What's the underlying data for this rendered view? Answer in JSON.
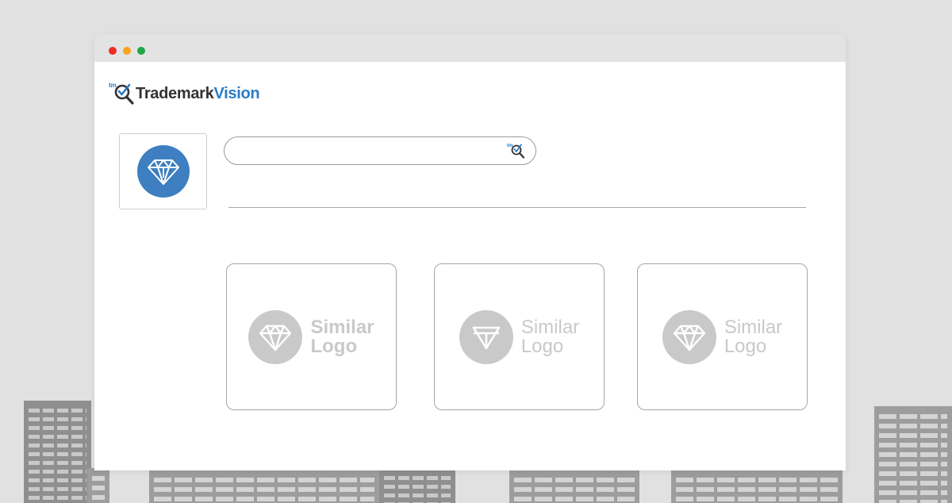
{
  "app": {
    "brand": {
      "prefix": "tm",
      "name_part1": "Trademark",
      "name_part2": "Vision"
    }
  },
  "window": {
    "controls": [
      "close",
      "minimize",
      "maximize"
    ]
  },
  "search": {
    "value": "",
    "placeholder": "",
    "button_icon": "tm-magnifier-check-icon"
  },
  "query_image": {
    "icon": "diamond-icon",
    "color": "#3d7fc0"
  },
  "results": [
    {
      "icon": "diamond-icon",
      "line1": "Similar",
      "line2": "Logo"
    },
    {
      "icon": "diamond-simple-icon",
      "line1": "Similar",
      "line2": "Logo"
    },
    {
      "icon": "diamond-icon",
      "line1": "Similar",
      "line2": "Logo"
    }
  ],
  "colors": {
    "accent": "#2a7cc7",
    "placeholder_gray": "#c9c9c9",
    "background": "#e1e1e1"
  }
}
